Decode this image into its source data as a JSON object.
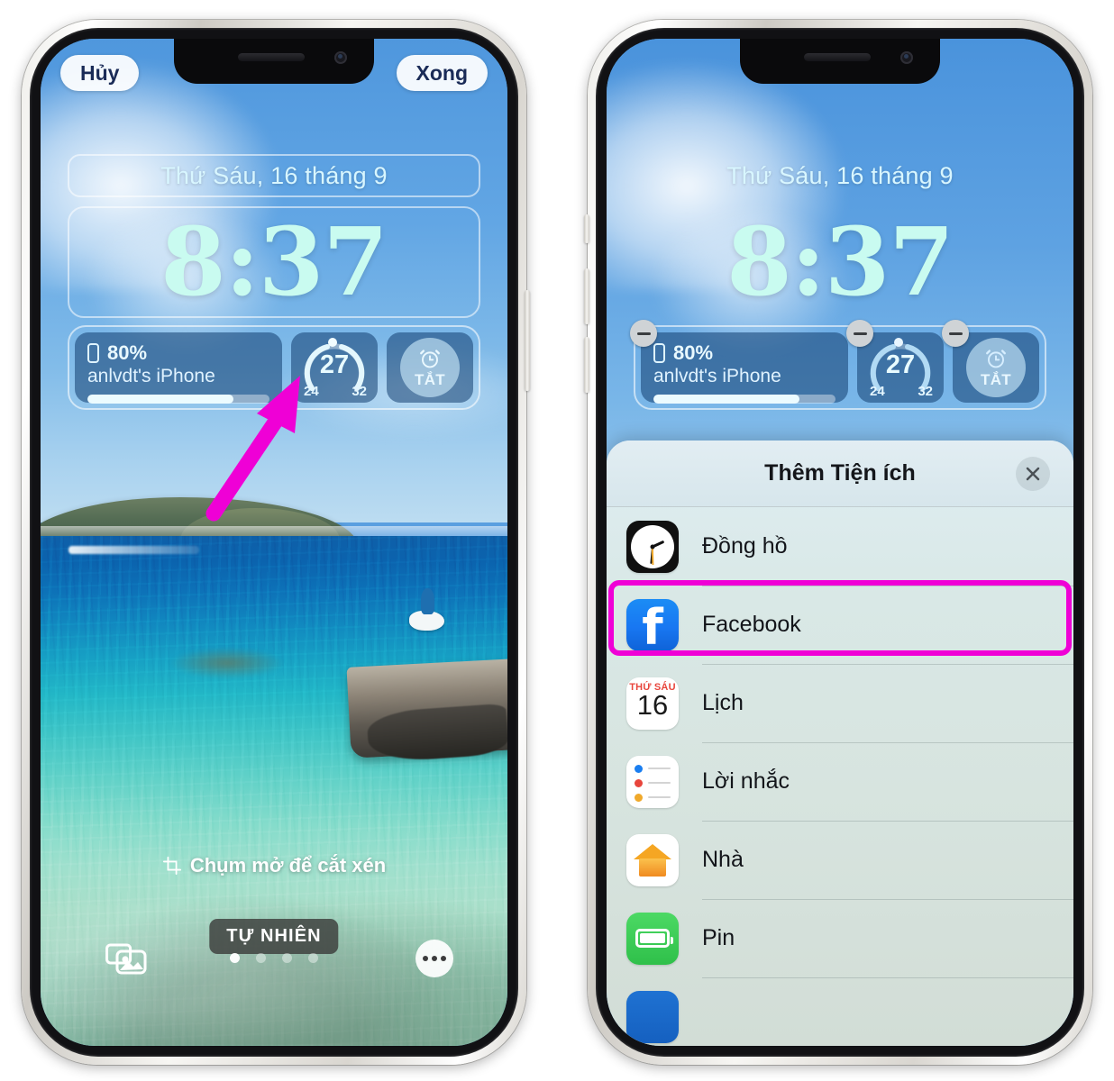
{
  "lockscreen": {
    "cancel_label": "Hủy",
    "done_label": "Xong",
    "date": "Thứ Sáu, 16 tháng 9",
    "time": "8:37",
    "widgets": {
      "battery": {
        "percent": "80%",
        "device_name": "anlvdt's iPhone",
        "fill_percent": 80,
        "icon": "phone-battery-icon"
      },
      "weather": {
        "current": "27",
        "low": "24",
        "high": "32",
        "icon": "temperature-gauge-icon"
      },
      "alarm": {
        "status": "TẮT",
        "icon": "alarm-clock-icon"
      }
    },
    "crop_hint": "Chụm mở để cắt xén",
    "crop_icon": "crop-icon",
    "style_badge": "TỰ NHIÊN",
    "photos_icon": "photo-library-icon",
    "more_icon": "more-dots-icon",
    "page_dots": 4,
    "active_dot": 0,
    "remove_widget_icon": "minus-circle-icon"
  },
  "sheet": {
    "title": "Thêm Tiện ích",
    "close_icon": "close-icon",
    "apps": [
      {
        "label": "Đồng hồ",
        "icon": "clock-app-icon",
        "highlighted": false
      },
      {
        "label": "Facebook",
        "icon": "facebook-app-icon",
        "highlighted": true
      },
      {
        "label": "Lịch",
        "icon": "calendar-app-icon",
        "highlighted": false,
        "calendar_weekday": "THỨ SÁU",
        "calendar_day": "16"
      },
      {
        "label": "Lời nhắc",
        "icon": "reminders-app-icon",
        "highlighted": false
      },
      {
        "label": "Nhà",
        "icon": "home-app-icon",
        "highlighted": false
      },
      {
        "label": "Pin",
        "icon": "battery-app-icon",
        "highlighted": false
      }
    ]
  },
  "annotation": {
    "arrow_color": "#ef00d6",
    "highlight_color": "#ef00d6"
  }
}
